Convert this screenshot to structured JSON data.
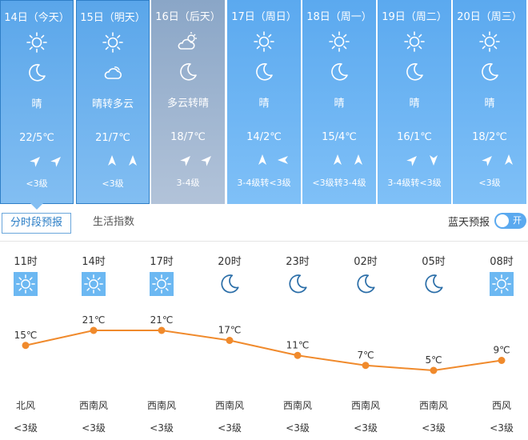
{
  "days": [
    {
      "date": "14日（今天）",
      "day_icon": "sun-icon",
      "night_icon": "moon-icon",
      "desc": "晴",
      "temp": "22/5℃",
      "wind_icons": [
        "arrow-northeast-icon",
        "arrow-northeast-icon"
      ],
      "level": "<3级",
      "state": "selected"
    },
    {
      "date": "15日（明天）",
      "day_icon": "sun-icon",
      "night_icon": "cloud-icon",
      "desc": "晴转多云",
      "temp": "21/7℃",
      "wind_icons": [
        "arrow-north-icon",
        "arrow-north-icon"
      ],
      "level": "<3级",
      "state": "selected"
    },
    {
      "date": "16日（后天）",
      "day_icon": "partly-cloudy-icon",
      "night_icon": "moon-icon",
      "desc": "多云转晴",
      "temp": "18/7℃",
      "wind_icons": [
        "arrow-northeast-icon",
        "arrow-northeast-icon"
      ],
      "level": "3-4级",
      "state": "past"
    },
    {
      "date": "17日（周日）",
      "day_icon": "sun-icon",
      "night_icon": "moon-icon",
      "desc": "晴",
      "temp": "14/2℃",
      "wind_icons": [
        "arrow-north-icon",
        "arrow-west-icon"
      ],
      "level": "3-4级转<3级",
      "state": "normal"
    },
    {
      "date": "18日（周一）",
      "day_icon": "sun-icon",
      "night_icon": "moon-icon",
      "desc": "晴",
      "temp": "15/4℃",
      "wind_icons": [
        "arrow-north-icon",
        "arrow-north-icon"
      ],
      "level": "<3级转3-4级",
      "state": "normal"
    },
    {
      "date": "19日（周二）",
      "day_icon": "sun-icon",
      "night_icon": "moon-icon",
      "desc": "晴",
      "temp": "16/1℃",
      "wind_icons": [
        "arrow-northeast-icon",
        "arrow-south-icon"
      ],
      "level": "3-4级转<3级",
      "state": "normal"
    },
    {
      "date": "20日（周三）",
      "day_icon": "sun-icon",
      "night_icon": "moon-icon",
      "desc": "晴",
      "temp": "18/2℃",
      "wind_icons": [
        "arrow-northeast-icon",
        "arrow-north-icon"
      ],
      "level": "<3级",
      "state": "normal"
    }
  ],
  "tabs": {
    "hourly": "分时段预报",
    "life": "生活指数"
  },
  "blue_sky": {
    "label": "蓝天预报",
    "toggle": "开"
  },
  "hourly": {
    "times": [
      "11时",
      "14时",
      "17时",
      "20时",
      "23时",
      "02时",
      "05时",
      "08时"
    ],
    "icons": [
      "sun-icon",
      "sun-icon",
      "sun-icon",
      "moon-icon",
      "moon-icon",
      "moon-icon",
      "moon-icon",
      "sun-icon"
    ],
    "directions": [
      "北风",
      "西南风",
      "西南风",
      "西南风",
      "西南风",
      "西南风",
      "西南风",
      "西风"
    ],
    "levels": [
      "<3级",
      "<3级",
      "<3级",
      "<3级",
      "<3级",
      "<3级",
      "<3级",
      "<3级"
    ]
  },
  "chart_data": {
    "type": "line",
    "x": [
      "11时",
      "14时",
      "17时",
      "20时",
      "23时",
      "02时",
      "05时",
      "08时"
    ],
    "series": [
      {
        "values": [
          15,
          21,
          21,
          17,
          11,
          7,
          5,
          9
        ]
      }
    ],
    "labels": [
      "15℃",
      "21℃",
      "21℃",
      "17℃",
      "11℃",
      "7℃",
      "5℃",
      "9℃"
    ],
    "line_color": "#f08a2c",
    "grid": false
  },
  "colors": {
    "accent": "#5ba9ef",
    "past": "#8aa6c7",
    "line": "#f08a2c"
  }
}
